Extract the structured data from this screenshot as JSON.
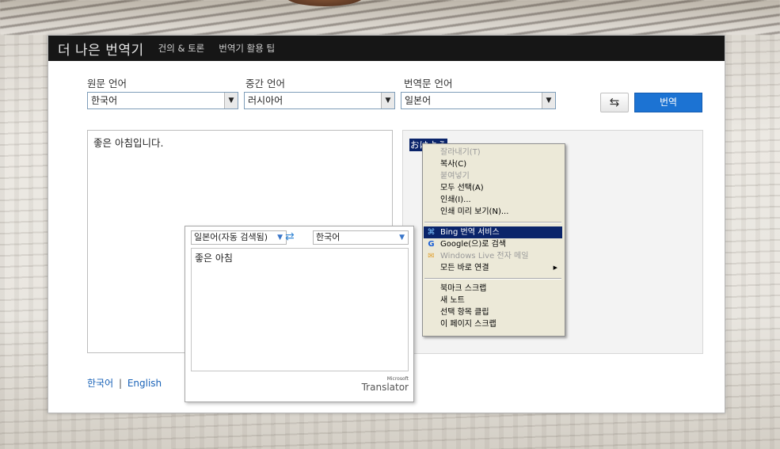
{
  "header": {
    "brand": "더 나은 번역기",
    "nav": [
      "건의 & 토론",
      "번역기 활용 팁"
    ]
  },
  "languages": {
    "source_label": "원문 언어",
    "source_value": "한국어",
    "pivot_label": "중간 언어",
    "pivot_value": "러시아어",
    "target_label": "번역문 언어",
    "target_value": "일본어"
  },
  "actions": {
    "swap_icon": "swap-arrows-icon",
    "translate_label": "번역"
  },
  "source_text": "좋은 아침입니다.",
  "output_selected_text": "おはよう",
  "footer": {
    "korean": "한국어",
    "separator": "|",
    "english": "English"
  },
  "translator_popup": {
    "from_lang": "일본어(자동 검색됨)",
    "to_lang": "한국어",
    "result": "좋은 아침",
    "logo_small": "Microsoft",
    "logo_main": "Translator"
  },
  "context_menu": {
    "items": [
      {
        "label": "잘라내기(T)",
        "enabled": false
      },
      {
        "label": "복사(C)",
        "enabled": true
      },
      {
        "label": "붙여넣기",
        "enabled": false
      },
      {
        "label": "모두 선택(A)",
        "enabled": true
      },
      {
        "label": "인쇄(I)...",
        "enabled": true
      },
      {
        "label": "인쇄 미리 보기(N)...",
        "enabled": true
      },
      {
        "label": "Bing 번역 서비스",
        "enabled": true,
        "highlighted": true,
        "icon": "bing-translator-icon"
      },
      {
        "label": "Google(으)로 검색",
        "enabled": true,
        "icon": "google-icon"
      },
      {
        "label": "Windows Live 전자 메일",
        "enabled": false,
        "icon": "windows-live-mail-icon"
      },
      {
        "label": "모든 바로 연결",
        "enabled": true,
        "submenu": true
      },
      {
        "label": "북마크 스크랩",
        "enabled": true
      },
      {
        "label": "새 노트",
        "enabled": true
      },
      {
        "label": "선택 항목 클립",
        "enabled": true
      },
      {
        "label": "이 페이지 스크랩",
        "enabled": true
      }
    ]
  }
}
